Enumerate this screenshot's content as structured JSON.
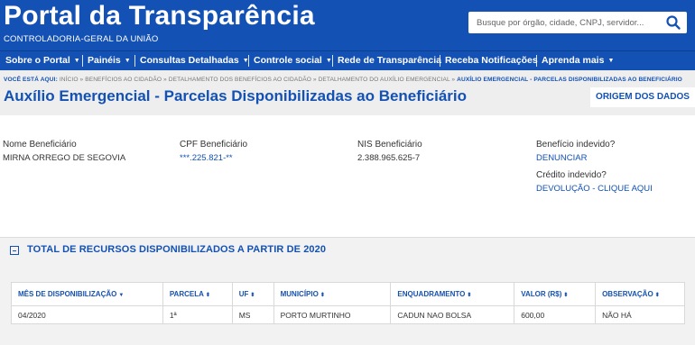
{
  "header": {
    "title": "Portal da Transparência",
    "subtitle": "CONTROLADORIA-GERAL DA UNIÃO",
    "search_placeholder": "Busque por órgão, cidade, CNPJ, servidor..."
  },
  "nav": {
    "items": [
      {
        "label": "Sobre o Portal",
        "has_dropdown": true
      },
      {
        "label": "Painéis",
        "has_dropdown": true
      },
      {
        "label": "Consultas Detalhadas",
        "has_dropdown": true
      },
      {
        "label": "Controle social",
        "has_dropdown": true
      },
      {
        "label": "Rede de Transparência",
        "has_dropdown": false
      },
      {
        "label": "Receba Notificações",
        "has_dropdown": false
      },
      {
        "label": "Aprenda mais",
        "has_dropdown": true
      }
    ]
  },
  "breadcrumb": {
    "prefix": "VOCÊ ESTÁ AQUI:",
    "items": [
      "INÍCIO",
      "BENEFÍCIOS AO CIDADÃO",
      "DETALHAMENTO DOS BENEFÍCIOS AO CIDADÃO",
      "DETALHAMENTO DO AUXÍLIO EMERGENCIAL"
    ],
    "current": "AUXÍLIO EMERGENCIAL - PARCELAS DISPONIBILIZADAS AO BENEFICIÁRIO"
  },
  "page": {
    "title": "Auxílio Emergencial - Parcelas Disponibilizadas ao Beneficiário",
    "origin_button": "ORIGEM DOS DADOS"
  },
  "beneficiary": {
    "name_label": "Nome Beneficiário",
    "name_value": "MIRNA ORREGO DE SEGOVIA",
    "cpf_label": "CPF Beneficiário",
    "cpf_value": "***.225.821-**",
    "nis_label": "NIS Beneficiário",
    "nis_value": "2.388.965.625-7",
    "undue_benefit_label": "Benefício indevido?",
    "undue_benefit_link": "DENUNCIAR",
    "undue_credit_label": "Crédito indevido?",
    "undue_credit_link": "DEVOLUÇÃO - CLIQUE AQUI"
  },
  "panel": {
    "title": "TOTAL DE RECURSOS DISPONIBILIZADOS A PARTIR DE 2020"
  },
  "table": {
    "columns": [
      "MÊS DE DISPONIBILIZAÇÃO",
      "PARCELA",
      "UF",
      "MUNICÍPIO",
      "ENQUADRAMENTO",
      "VALOR (R$)",
      "OBSERVAÇÃO"
    ],
    "rows": [
      [
        "04/2020",
        "1ª",
        "MS",
        "PORTO MURTINHO",
        "CADUN NAO BOLSA",
        "600,00",
        "NÃO HÁ"
      ]
    ]
  },
  "colors": {
    "brand_blue": "#1351b4",
    "light_gray": "#eeeeee"
  }
}
